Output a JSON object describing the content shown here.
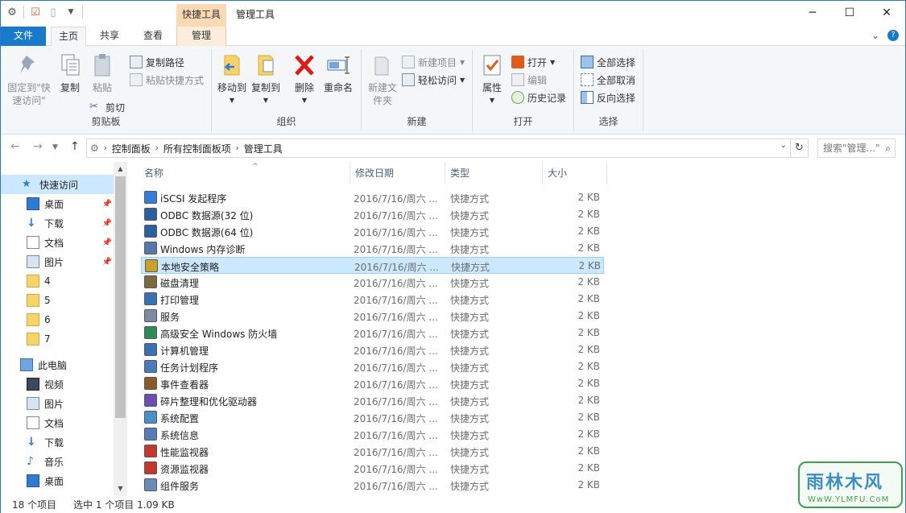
{
  "titlebar": {
    "context_tab": "快捷工具",
    "title": "管理工具",
    "minimize": "─",
    "maximize": "☐",
    "close": "✕"
  },
  "tabs": {
    "file": "文件",
    "home": "主页",
    "share": "共享",
    "view": "查看",
    "manage": "管理"
  },
  "ribbon": {
    "clipboard": {
      "label": "剪贴板",
      "pin": "固定到\"快速访问\"",
      "copy": "复制",
      "paste": "粘贴",
      "copy_path": "复制路径",
      "paste_shortcut": "粘贴快捷方式",
      "cut": "剪切"
    },
    "organize": {
      "label": "组织",
      "move_to": "移动到",
      "copy_to": "复制到",
      "delete": "删除",
      "rename": "重命名"
    },
    "new": {
      "label": "新建",
      "new_folder": "新建文件夹",
      "new_item": "新建项目",
      "easy_access": "轻松访问"
    },
    "open": {
      "label": "打开",
      "properties": "属性",
      "open": "打开",
      "edit": "编辑",
      "history": "历史记录"
    },
    "select": {
      "label": "选择",
      "select_all": "全部选择",
      "select_none": "全部取消",
      "invert": "反向选择"
    }
  },
  "address": {
    "crumbs": [
      "控制面板",
      "所有控制面板项",
      "管理工具"
    ],
    "search_placeholder": "搜索\"管理...\""
  },
  "nav": {
    "quick_access": "快速访问",
    "items": [
      "桌面",
      "下载",
      "文档",
      "图片",
      "4",
      "5",
      "6",
      "7"
    ],
    "this_pc": "此电脑",
    "pc_items": [
      "视频",
      "图片",
      "文档",
      "下载",
      "音乐",
      "桌面"
    ]
  },
  "columns": {
    "name": "名称",
    "date": "修改日期",
    "type": "类型",
    "size": "大小"
  },
  "files": [
    {
      "name": "iSCSI 发起程序",
      "date": "2016/7/16/周六 ...",
      "type": "快捷方式",
      "size": "2 KB"
    },
    {
      "name": "ODBC 数据源(32 位)",
      "date": "2016/7/16/周六 ...",
      "type": "快捷方式",
      "size": "2 KB"
    },
    {
      "name": "ODBC 数据源(64 位)",
      "date": "2016/7/16/周六 ...",
      "type": "快捷方式",
      "size": "2 KB"
    },
    {
      "name": "Windows 内存诊断",
      "date": "2016/7/16/周六 ...",
      "type": "快捷方式",
      "size": "2 KB"
    },
    {
      "name": "本地安全策略",
      "date": "2016/7/16/周六 ...",
      "type": "快捷方式",
      "size": "2 KB"
    },
    {
      "name": "磁盘清理",
      "date": "2016/7/16/周六 ...",
      "type": "快捷方式",
      "size": "2 KB"
    },
    {
      "name": "打印管理",
      "date": "2016/7/16/周六 ...",
      "type": "快捷方式",
      "size": "2 KB"
    },
    {
      "name": "服务",
      "date": "2016/7/16/周六 ...",
      "type": "快捷方式",
      "size": "2 KB"
    },
    {
      "name": "高级安全 Windows 防火墙",
      "date": "2016/7/16/周六 ...",
      "type": "快捷方式",
      "size": "2 KB"
    },
    {
      "name": "计算机管理",
      "date": "2016/7/16/周六 ...",
      "type": "快捷方式",
      "size": "2 KB"
    },
    {
      "name": "任务计划程序",
      "date": "2016/7/16/周六 ...",
      "type": "快捷方式",
      "size": "2 KB"
    },
    {
      "name": "事件查看器",
      "date": "2016/7/16/周六 ...",
      "type": "快捷方式",
      "size": "2 KB"
    },
    {
      "name": "碎片整理和优化驱动器",
      "date": "2016/7/16/周六 ...",
      "type": "快捷方式",
      "size": "2 KB"
    },
    {
      "name": "系统配置",
      "date": "2016/7/16/周六 ...",
      "type": "快捷方式",
      "size": "2 KB"
    },
    {
      "name": "系统信息",
      "date": "2016/7/16/周六 ...",
      "type": "快捷方式",
      "size": "2 KB"
    },
    {
      "name": "性能监视器",
      "date": "2016/7/16/周六 ...",
      "type": "快捷方式",
      "size": "2 KB"
    },
    {
      "name": "资源监视器",
      "date": "2016/7/16/周六 ...",
      "type": "快捷方式",
      "size": "2 KB"
    },
    {
      "name": "组件服务",
      "date": "2016/7/16/周六 ...",
      "type": "快捷方式",
      "size": "2 KB"
    }
  ],
  "status": {
    "count": "18 个项目",
    "selection": "选中 1 个项目  1.09 KB"
  },
  "watermark": {
    "title": "雨林木风",
    "url": "WwW.YLMFU.CoM"
  }
}
